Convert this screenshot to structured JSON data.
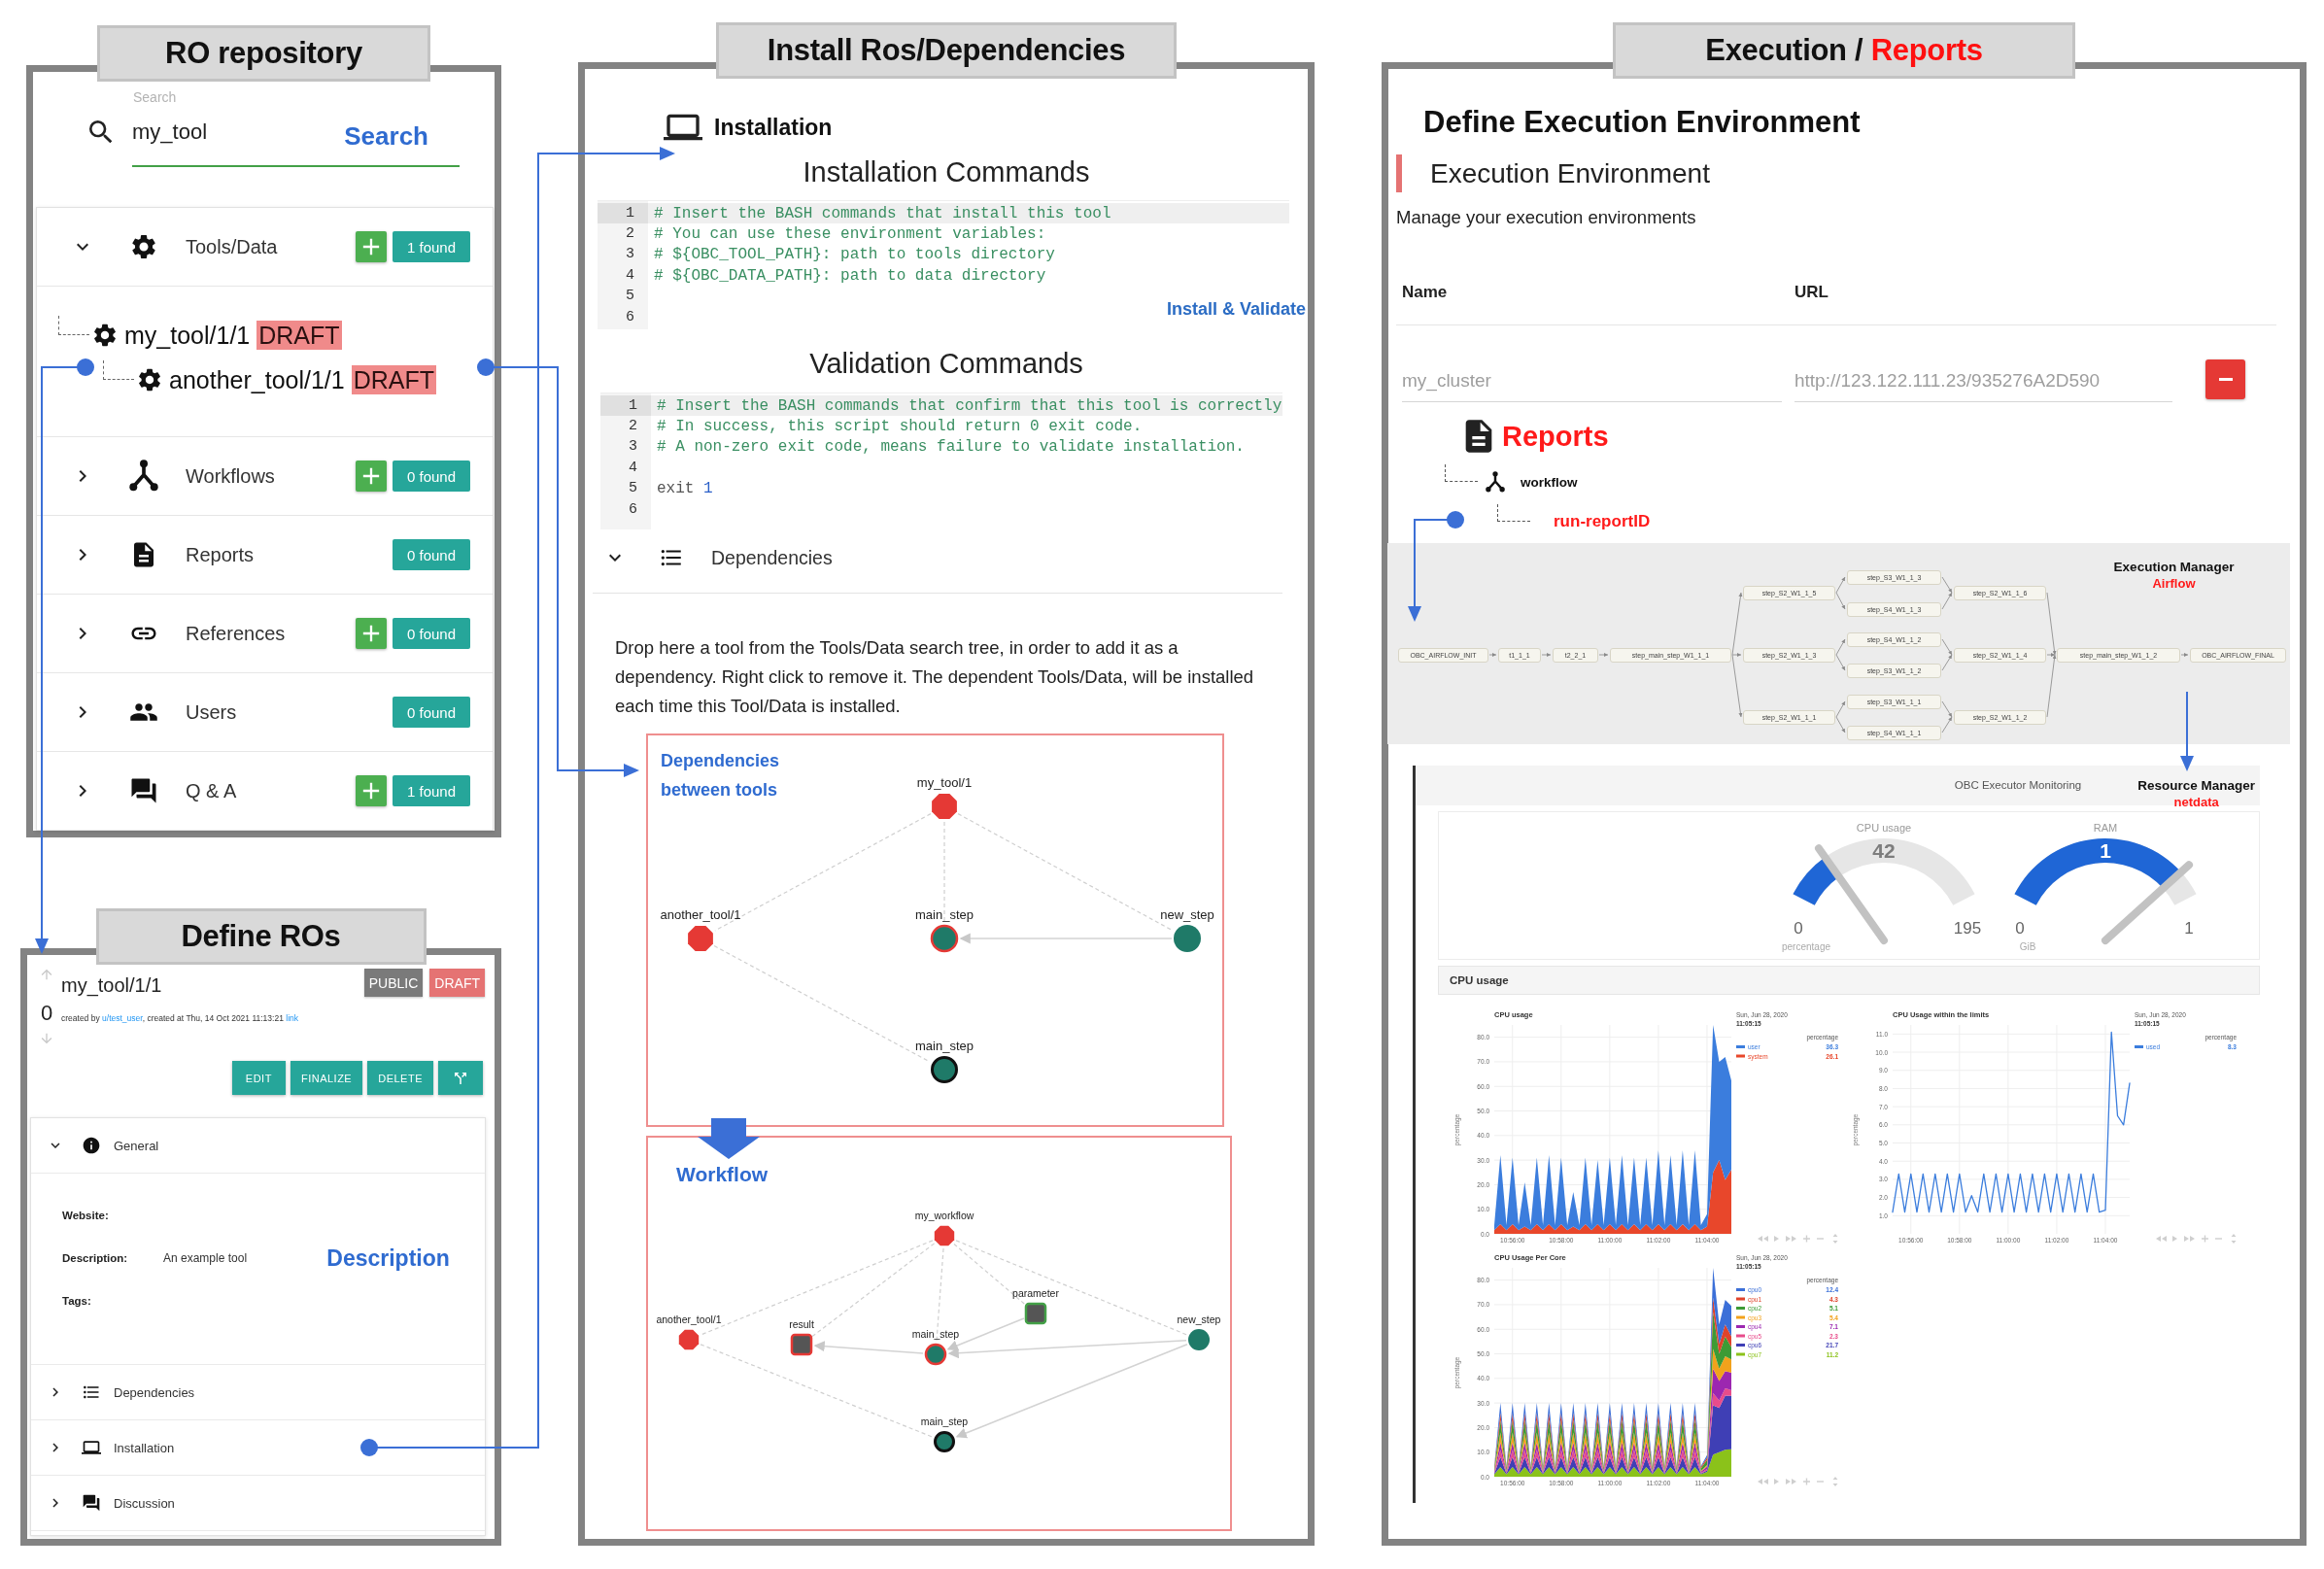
{
  "repository": {
    "title": "RO repository",
    "search": {
      "label": "Search",
      "value": "my_tool",
      "button": "Search"
    },
    "categories": [
      {
        "kind": "tools",
        "label": "Tools/Data",
        "expanded": true,
        "can_add": true,
        "count": "1 found",
        "children": [
          {
            "label": "my_tool/1/1",
            "status": "DRAFT",
            "children": [
              {
                "label": "another_tool/1/1",
                "status": "DRAFT"
              }
            ]
          }
        ]
      },
      {
        "kind": "workflows",
        "label": "Workflows",
        "expanded": false,
        "can_add": true,
        "count": "0 found"
      },
      {
        "kind": "reports",
        "label": "Reports",
        "expanded": false,
        "can_add": false,
        "count": "0 found"
      },
      {
        "kind": "references",
        "label": "References",
        "expanded": false,
        "can_add": true,
        "count": "0 found"
      },
      {
        "kind": "users",
        "label": "Users",
        "expanded": false,
        "can_add": false,
        "count": "0 found"
      },
      {
        "kind": "qa",
        "label": "Q & A",
        "expanded": false,
        "can_add": true,
        "count": "1 found"
      }
    ]
  },
  "define_ros": {
    "title": "Define ROs",
    "votes": "0",
    "name": "my_tool/1/1",
    "badges": [
      {
        "kind": "public",
        "label": "PUBLIC"
      },
      {
        "kind": "draft",
        "label": "DRAFT"
      }
    ],
    "meta": [
      {
        "kind": "text",
        "text": "created by "
      },
      {
        "kind": "link",
        "text": "u/test_user"
      },
      {
        "kind": "text",
        "text": ", created at Thu, 14 Oct 2021 11:13:21 "
      },
      {
        "kind": "link",
        "text": "link"
      }
    ],
    "actions": [
      {
        "kind": "label",
        "label": "EDIT"
      },
      {
        "kind": "label",
        "label": "FINALIZE"
      },
      {
        "kind": "label",
        "label": "DELETE"
      },
      {
        "kind": "fork"
      }
    ],
    "sections": [
      {
        "kind": "general",
        "label": "General",
        "expanded": true,
        "fields": [
          {
            "label": "Website:"
          },
          {
            "label": "Description:",
            "value": "An example tool",
            "annotation": "Description"
          },
          {
            "label": "Tags:"
          }
        ]
      },
      {
        "kind": "dependencies",
        "label": "Dependencies",
        "expanded": false
      },
      {
        "kind": "installation",
        "label": "Installation",
        "expanded": false
      },
      {
        "kind": "discussion",
        "label": "Discussion",
        "expanded": false
      }
    ]
  },
  "install": {
    "title": "Install Ros/Dependencies",
    "heading": "Installation",
    "editors": [
      {
        "title": "Installation Commands",
        "annotation": "Install & Validate",
        "lines": [
          {
            "number": "1",
            "active": true,
            "tokens": [
              {
                "kind": "comment",
                "text": "# Insert the BASH commands that install this tool"
              }
            ]
          },
          {
            "number": "2",
            "active": false,
            "tokens": [
              {
                "kind": "comment",
                "text": "# You can use these environment variables:"
              }
            ]
          },
          {
            "number": "3",
            "active": false,
            "tokens": [
              {
                "kind": "comment",
                "text": "# ${OBC_TOOL_PATH}: path to tools directory"
              }
            ]
          },
          {
            "number": "4",
            "active": false,
            "tokens": [
              {
                "kind": "comment",
                "text": "# ${OBC_DATA_PATH}: path to data directory"
              }
            ]
          },
          {
            "number": "5",
            "active": false
          },
          {
            "number": "6",
            "active": false
          }
        ]
      },
      {
        "title": "Validation Commands",
        "lines": [
          {
            "number": "1",
            "active": true,
            "tokens": [
              {
                "kind": "comment",
                "text": "# Insert the BASH commands that confirm that this tool is correctly"
              }
            ]
          },
          {
            "number": "2",
            "active": false,
            "tokens": [
              {
                "kind": "comment",
                "text": "# In success, this script should return 0 exit code."
              }
            ]
          },
          {
            "number": "3",
            "active": false,
            "tokens": [
              {
                "kind": "comment",
                "text": "# A non-zero exit code, means failure to validate installation."
              }
            ]
          },
          {
            "number": "4",
            "active": false
          },
          {
            "number": "5",
            "active": false,
            "tokens": [
              {
                "kind": "keyword",
                "text": "exit "
              },
              {
                "kind": "number",
                "text": "1"
              }
            ]
          },
          {
            "number": "6",
            "active": false
          }
        ]
      }
    ],
    "dependencies": {
      "label": "Dependencies",
      "expanded": true,
      "hint": "Drop here a tool from the Tools/Data search tree, in order to add it as a dependency. Right click to remove it. The dependent Tools/Data, will be installed each time this Tool/Data is installed."
    },
    "graphs": [
      {
        "title": "Dependencies between tools",
        "nodes": [
          {
            "label": "my_tool/1",
            "kind": "tool"
          },
          {
            "label": "another_tool/1",
            "kind": "tool"
          },
          {
            "label": "main_step",
            "kind": "step-current"
          },
          {
            "label": "new_step",
            "kind": "step"
          },
          {
            "label": "main_step",
            "kind": "step-final"
          }
        ]
      },
      {
        "title": "Workflow",
        "nodes": [
          {
            "label": "my_workflow",
            "kind": "tool"
          },
          {
            "label": "another_tool/1",
            "kind": "tool"
          },
          {
            "label": "result",
            "kind": "result"
          },
          {
            "label": "main_step",
            "kind": "step-current"
          },
          {
            "label": "parameter",
            "kind": "parameter"
          },
          {
            "label": "new_step",
            "kind": "step"
          },
          {
            "label": "main_step",
            "kind": "step-final"
          }
        ]
      }
    ]
  },
  "execution": {
    "title": [
      {
        "text": "Execution /",
        "highlight": false
      },
      {
        "text": "Reports",
        "highlight": true
      }
    ],
    "heading": "Define Execution Environment",
    "section": "Execution Environment",
    "description": "Manage your execution environments",
    "table": {
      "columns": [
        "Name",
        "URL"
      ],
      "rows": [
        {
          "name": "my_cluster",
          "url": "http://123.122.111.23/935276A2D590"
        }
      ]
    },
    "reports": {
      "title": "Reports",
      "children": [
        {
          "kind": "workflow",
          "label": "workflow",
          "children": [
            {
              "kind": "report",
              "label": "run-reportID"
            }
          ]
        }
      ]
    },
    "airflow": {
      "title": "Execution Manager",
      "engine": "Airflow",
      "nodes": [
        {
          "label": "OBC_AIRFLOW_INIT"
        },
        {
          "label": "t1_1_1"
        },
        {
          "label": "t2_2_1"
        },
        {
          "label": "step_main_step_W1_1_1"
        },
        {
          "label": "step_S2_W1_1_5"
        },
        {
          "label": "step_S2_W1_1_3"
        },
        {
          "label": "step_S2_W1_1_1"
        },
        {
          "label": "step_S3_W1_1_3"
        },
        {
          "label": "step_S4_W1_1_3"
        },
        {
          "label": "step_S4_W1_1_2"
        },
        {
          "label": "step_S3_W1_1_2"
        },
        {
          "label": "step_S3_W1_1_1"
        },
        {
          "label": "step_S4_W1_1_1"
        },
        {
          "label": "step_S2_W1_1_6"
        },
        {
          "label": "step_S2_W1_1_4"
        },
        {
          "label": "step_S2_W1_1_2"
        },
        {
          "label": "step_main_step_W1_1_2"
        },
        {
          "label": "OBC_AIRFLOW_FINAL"
        }
      ]
    },
    "monitoring": {
      "title": "OBC Executor Monitoring",
      "manager": "Resource Manager",
      "engine": "netdata",
      "gauges": [
        {
          "title": "CPU usage",
          "reading": "42",
          "min": "0",
          "max": "195",
          "unit": "percentage",
          "level": 0.22
        },
        {
          "title": "RAM",
          "reading": "1",
          "min": "0",
          "max": "1",
          "unit": "GiB",
          "level": 0.88
        }
      ],
      "section": "CPU usage",
      "charts": [
        {
          "date": "Sun, Jun 28, 2020",
          "time": "11:05:15",
          "unit": "percentage",
          "readings": [
            "36.3",
            "26.1"
          ],
          "chart_data": {
            "type": "area",
            "title": "CPU usage",
            "ylabel": "percentage",
            "stacked": true,
            "grid": true,
            "legend": true,
            "categories": [
              null,
              null,
              null,
              "10:56:00",
              null,
              null,
              null,
              null,
              null,
              null,
              null,
              "10:58:00",
              null,
              null,
              null,
              null,
              null,
              null,
              null,
              "11:00:00",
              null,
              null,
              null,
              null,
              null,
              null,
              null,
              "11:02:00",
              null,
              null,
              null,
              null,
              null,
              null,
              null,
              "11:04:00",
              null,
              null,
              null,
              null
            ],
            "ylim": [
              0,
              85
            ],
            "yticks": [
              {
                "value": 0,
                "label": "0.0"
              },
              {
                "value": 10,
                "label": "10.0"
              },
              {
                "value": 20,
                "label": "20.0"
              },
              {
                "value": 30,
                "label": "30.0"
              },
              {
                "value": 40,
                "label": "40.0"
              },
              {
                "value": 50,
                "label": "50.0"
              },
              {
                "value": 60,
                "label": "60.0"
              },
              {
                "value": 70,
                "label": "70.0"
              },
              {
                "value": 80,
                "label": "80.0"
              }
            ],
            "series": [
              {
                "name": "user",
                "color": "#3b7ddd",
                "values": [
                  2,
                  28,
                  2,
                  27,
                  2,
                  18,
                  2,
                  27,
                  2,
                  28,
                  2,
                  27,
                  2,
                  14,
                  2,
                  27,
                  2,
                  26,
                  2,
                  27,
                  2,
                  28,
                  2,
                  27,
                  2,
                  27,
                  2,
                  30,
                  2,
                  28,
                  2,
                  30,
                  2,
                  30,
                  2,
                  5,
                  60,
                  40,
                  50,
                  36.3
                ]
              },
              {
                "name": "system",
                "color": "#e8472b",
                "values": [
                  1.5,
                  4,
                  1.5,
                  4,
                  1.5,
                  3,
                  1.5,
                  4,
                  1.5,
                  4,
                  1.5,
                  4,
                  1.5,
                  3,
                  1.5,
                  4,
                  1.5,
                  4,
                  1.5,
                  4,
                  1.5,
                  4,
                  1.5,
                  4,
                  1.5,
                  4,
                  1.5,
                  4,
                  1.5,
                  4,
                  1.5,
                  4,
                  1.5,
                  4,
                  1.5,
                  3,
                  25,
                  30,
                  22,
                  26.1
                ]
              }
            ]
          }
        },
        {
          "date": "Sun, Jun 28, 2020",
          "time": "11:05:15",
          "unit": "percentage",
          "readings": [
            "8.3"
          ],
          "chart_data": {
            "type": "line",
            "title": "CPU Usage within the limits",
            "ylabel": "percentage",
            "grid": true,
            "legend": true,
            "categories": [
              null,
              null,
              null,
              "10:56:00",
              null,
              null,
              null,
              null,
              null,
              null,
              null,
              "10:58:00",
              null,
              null,
              null,
              null,
              null,
              null,
              null,
              "11:00:00",
              null,
              null,
              null,
              null,
              null,
              null,
              null,
              "11:02:00",
              null,
              null,
              null,
              null,
              null,
              null,
              null,
              "11:04:00",
              null,
              null,
              null,
              null
            ],
            "ylim": [
              0,
              11.5
            ],
            "yticks": [
              {
                "value": 1,
                "label": "1.0"
              },
              {
                "value": 2,
                "label": "2.0"
              },
              {
                "value": 3,
                "label": "3.0"
              },
              {
                "value": 4,
                "label": "4.0"
              },
              {
                "value": 5,
                "label": "5.0"
              },
              {
                "value": 6,
                "label": "6.0"
              },
              {
                "value": 7,
                "label": "7.0"
              },
              {
                "value": 8,
                "label": "8.0"
              },
              {
                "value": 9,
                "label": "9.0"
              },
              {
                "value": 10,
                "label": "10.0"
              },
              {
                "value": 11,
                "label": "11.0"
              }
            ],
            "series": [
              {
                "name": "used",
                "color": "#3b7ddd",
                "values": [
                  1.2,
                  3.3,
                  1.2,
                  3.3,
                  1.2,
                  3.3,
                  1.2,
                  3.3,
                  1.2,
                  3.3,
                  1.2,
                  3.3,
                  1.2,
                  2.1,
                  1.2,
                  3.3,
                  1.2,
                  3.3,
                  1.2,
                  3.3,
                  1.2,
                  3.3,
                  1.2,
                  3.3,
                  1.2,
                  3.3,
                  1.2,
                  3.3,
                  1.2,
                  3.3,
                  1.2,
                  3.3,
                  1.2,
                  3.3,
                  1.2,
                  1.3,
                  11.1,
                  6.5,
                  6,
                  8.3
                ]
              }
            ]
          }
        },
        {
          "date": "Sun, Jun 28, 2020",
          "time": "11:05:15",
          "unit": "percentage",
          "readings": [
            "12.4",
            "4.3",
            "5.1",
            "5.4",
            "7.1",
            "2.3",
            "21.7",
            "11.2"
          ],
          "chart_data": {
            "type": "area",
            "title": "CPU Usage Per Core",
            "ylabel": "percentage",
            "stacked": true,
            "grid": true,
            "legend": true,
            "categories": [
              null,
              null,
              null,
              "10:56:00",
              null,
              null,
              null,
              null,
              null,
              null,
              null,
              "10:58:00",
              null,
              null,
              null,
              null,
              null,
              null,
              null,
              "11:00:00",
              null,
              null,
              null,
              null,
              null,
              null,
              null,
              "11:02:00",
              null,
              null,
              null,
              null,
              null,
              null,
              null,
              "11:04:00",
              null,
              null,
              null,
              null
            ],
            "ylim": [
              0,
              85
            ],
            "yticks": [
              {
                "value": 0,
                "label": "0.0"
              },
              {
                "value": 10,
                "label": "10.0"
              },
              {
                "value": 20,
                "label": "20.0"
              },
              {
                "value": 30,
                "label": "30.0"
              },
              {
                "value": 40,
                "label": "40.0"
              },
              {
                "value": 50,
                "label": "50.0"
              },
              {
                "value": 60,
                "label": "60.0"
              },
              {
                "value": 70,
                "label": "70.0"
              },
              {
                "value": 80,
                "label": "80.0"
              }
            ],
            "series": [
              {
                "name": "cpu0",
                "color": "#3b6fd8",
                "values": [
                  0.5,
                  4,
                  0.5,
                  4,
                  0.5,
                  4,
                  0.5,
                  4,
                  0.5,
                  4,
                  0.5,
                  4,
                  0.5,
                  4,
                  0.5,
                  4,
                  0.5,
                  4,
                  0.5,
                  4,
                  0.5,
                  4,
                  0.5,
                  4,
                  0.5,
                  4,
                  0.5,
                  4,
                  0.5,
                  4,
                  0.5,
                  4,
                  0.5,
                  4,
                  0.5,
                  1,
                  12,
                  8,
                  10,
                  12.4
                ]
              },
              {
                "name": "cpu1",
                "color": "#e0432b",
                "values": [
                  0.5,
                  3,
                  0.5,
                  3,
                  0.5,
                  3,
                  0.5,
                  3,
                  0.5,
                  3,
                  0.5,
                  3,
                  0.5,
                  3,
                  0.5,
                  3,
                  0.5,
                  3,
                  0.5,
                  3,
                  0.5,
                  3,
                  0.5,
                  3,
                  0.5,
                  3,
                  0.5,
                  3,
                  0.5,
                  3,
                  0.5,
                  3,
                  0.5,
                  3,
                  0.5,
                  1,
                  6,
                  4,
                  5,
                  4.3
                ]
              },
              {
                "name": "cpu2",
                "color": "#3d9b35",
                "values": [
                  1,
                  5,
                  1,
                  5,
                  1,
                  5,
                  1,
                  5,
                  1,
                  5,
                  1,
                  5,
                  1,
                  5,
                  1,
                  5,
                  1,
                  5,
                  1,
                  5,
                  1,
                  5,
                  1,
                  5,
                  1,
                  5,
                  1,
                  5,
                  1,
                  5,
                  1,
                  5,
                  1,
                  5,
                  1,
                  2,
                  15,
                  6,
                  8,
                  5.1
                ]
              },
              {
                "name": "cpu3",
                "color": "#f2a21c",
                "values": [
                  0.3,
                  4,
                  0.3,
                  4,
                  0.3,
                  4,
                  0.3,
                  4,
                  0.3,
                  4,
                  0.3,
                  4,
                  0.3,
                  4,
                  0.3,
                  4,
                  0.3,
                  4,
                  0.3,
                  4,
                  0.3,
                  4,
                  0.3,
                  4,
                  0.3,
                  4,
                  0.3,
                  4,
                  0.3,
                  4,
                  0.3,
                  4,
                  0.3,
                  4,
                  0.3,
                  0.6,
                  8,
                  5,
                  6,
                  5.4
                ]
              },
              {
                "name": "cpu4",
                "color": "#9c27b0",
                "values": [
                  0.5,
                  3,
                  0.5,
                  3,
                  0.5,
                  3,
                  0.5,
                  3,
                  0.5,
                  3,
                  0.5,
                  3,
                  0.5,
                  3,
                  0.5,
                  3,
                  0.5,
                  3,
                  0.5,
                  3,
                  0.5,
                  3,
                  0.5,
                  3,
                  0.5,
                  3,
                  0.5,
                  3,
                  0.5,
                  3,
                  0.5,
                  3,
                  0.5,
                  3,
                  0.5,
                  1,
                  10,
                  8,
                  7,
                  7.1
                ]
              },
              {
                "name": "cpu5",
                "color": "#e84c8b",
                "values": [
                  0.3,
                  3,
                  0.3,
                  3,
                  0.3,
                  3,
                  0.3,
                  3,
                  0.3,
                  3,
                  0.3,
                  3,
                  0.3,
                  3,
                  0.3,
                  3,
                  0.3,
                  3,
                  0.3,
                  3,
                  0.3,
                  3,
                  0.3,
                  3,
                  0.3,
                  3,
                  0.3,
                  3,
                  0.3,
                  3,
                  0.3,
                  3,
                  0.3,
                  3,
                  0.3,
                  0.6,
                  5,
                  3,
                  3,
                  2.3
                ]
              },
              {
                "name": "cpu6",
                "color": "#3f3fb5",
                "values": [
                  0.3,
                  4,
                  0.3,
                  4,
                  0.3,
                  4,
                  0.3,
                  4,
                  0.3,
                  4,
                  0.3,
                  4,
                  0.3,
                  4,
                  0.3,
                  4,
                  0.3,
                  4,
                  0.3,
                  4,
                  0.3,
                  4,
                  0.3,
                  4,
                  0.3,
                  4,
                  0.3,
                  4,
                  0.3,
                  4,
                  0.3,
                  4,
                  0.3,
                  4,
                  0.3,
                  0.6,
                  20,
                  18,
                  22,
                  21.7
                ]
              },
              {
                "name": "cpu7",
                "color": "#8bc21a",
                "values": [
                  1,
                  4,
                  1,
                  4,
                  1,
                  4,
                  1,
                  4,
                  1,
                  4,
                  1,
                  4,
                  1,
                  4,
                  1,
                  4,
                  1,
                  4,
                  1,
                  4,
                  1,
                  4,
                  1,
                  4,
                  1,
                  4,
                  1,
                  4,
                  1,
                  4,
                  1,
                  4,
                  1,
                  4,
                  1,
                  2,
                  9,
                  10,
                  11,
                  11.2
                ]
              }
            ]
          }
        }
      ]
    }
  }
}
